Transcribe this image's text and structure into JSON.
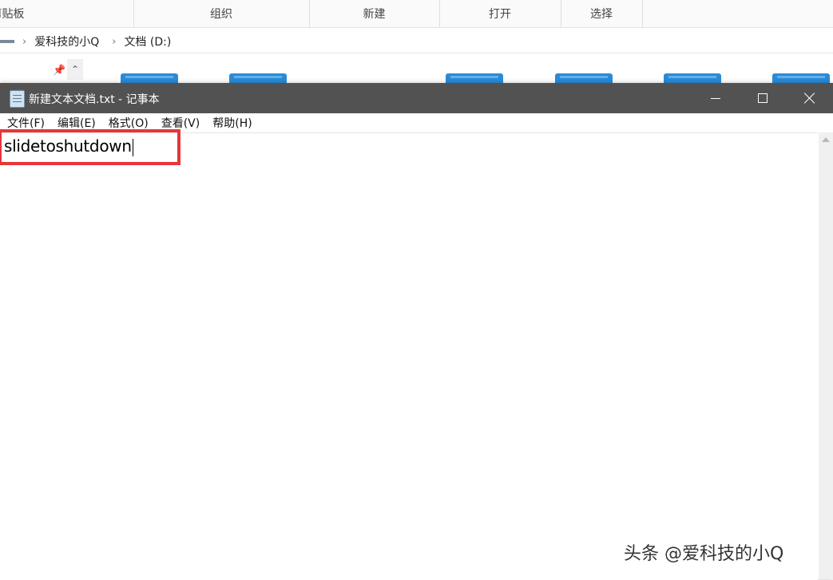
{
  "explorer": {
    "ribbon_groups": [
      "剪贴板",
      "组织",
      "新建",
      "打开",
      "选择"
    ],
    "breadcrumb": [
      "爱科技的小Q",
      "文档 (D:)"
    ]
  },
  "notepad": {
    "title": "新建文本文档.txt - 记事本",
    "menu": [
      "文件(F)",
      "编辑(E)",
      "格式(O)",
      "查看(V)",
      "帮助(H)"
    ],
    "content": "slidetoshutdown"
  },
  "watermark": "头条 @爱科技的小Q",
  "colors": {
    "titlebar": "#525252",
    "highlight_box": "#e8353a",
    "folder": "#2a8bd6"
  }
}
